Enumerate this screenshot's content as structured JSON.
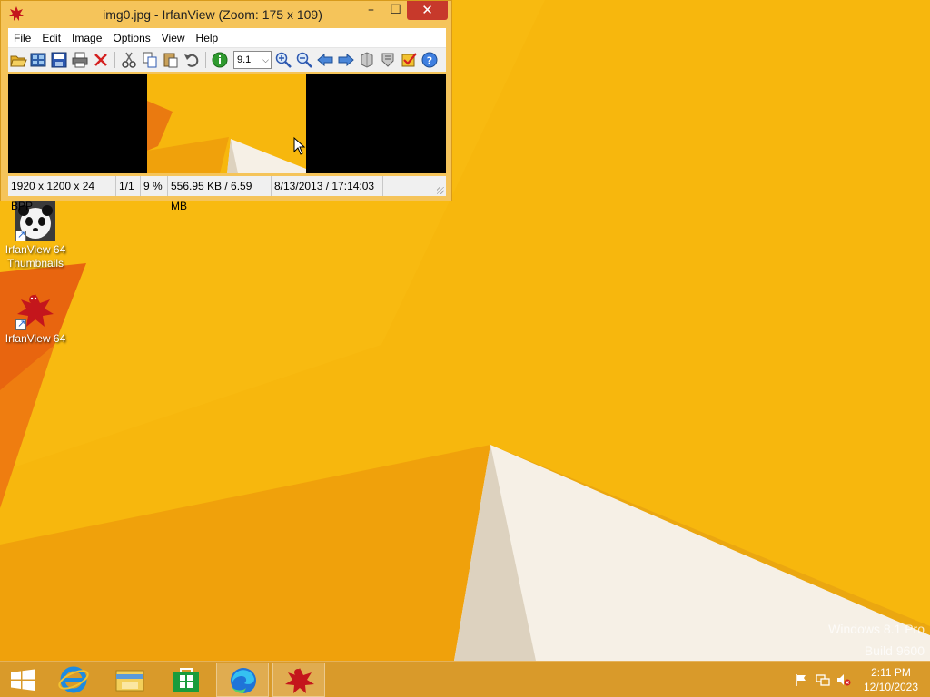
{
  "window": {
    "title": "img0.jpg - IrfanView (Zoom: 175 x 109)",
    "controls": {
      "minimize": "–",
      "maximize": "☐",
      "close": "✕"
    }
  },
  "menu": [
    "File",
    "Edit",
    "Image",
    "Options",
    "View",
    "Help"
  ],
  "toolbar": {
    "zoom_value": "9.1",
    "buttons": [
      "open-icon",
      "thumbnails-icon",
      "save-icon",
      "print-icon",
      "delete-icon",
      "cut-icon",
      "copy-icon",
      "paste-icon",
      "undo-icon",
      "info-icon",
      "zoom-in-icon",
      "zoom-out-icon",
      "previous-icon",
      "next-icon",
      "slideshow-icon",
      "properties-icon",
      "check-icon",
      "help-icon"
    ]
  },
  "status": {
    "dimensions": "1920 x 1200 x 24 BPP",
    "page": "1/1",
    "zoom": "9 %",
    "size": "556.95 KB / 6.59 MB",
    "date": "8/13/2013 / 17:14:03"
  },
  "desktop": {
    "icons": [
      {
        "label_line1": "IrfanView 64",
        "label_line2": "Thumbnails"
      },
      {
        "label_line1": "IrfanView 64",
        "label_line2": ""
      }
    ],
    "watermark_line1": "Windows 8.1 Pro",
    "watermark_line2": "Build 9600"
  },
  "taskbar": {
    "apps": [
      "start-icon",
      "internet-explorer-icon",
      "file-explorer-icon",
      "store-icon",
      "edge-icon",
      "irfanview-icon"
    ],
    "clock_time": "2:11 PM",
    "clock_date": "12/10/2023"
  },
  "colors": {
    "wallpaper": "#f5b40c",
    "taskbar": "#d99a2a",
    "close": "#c7392b"
  }
}
